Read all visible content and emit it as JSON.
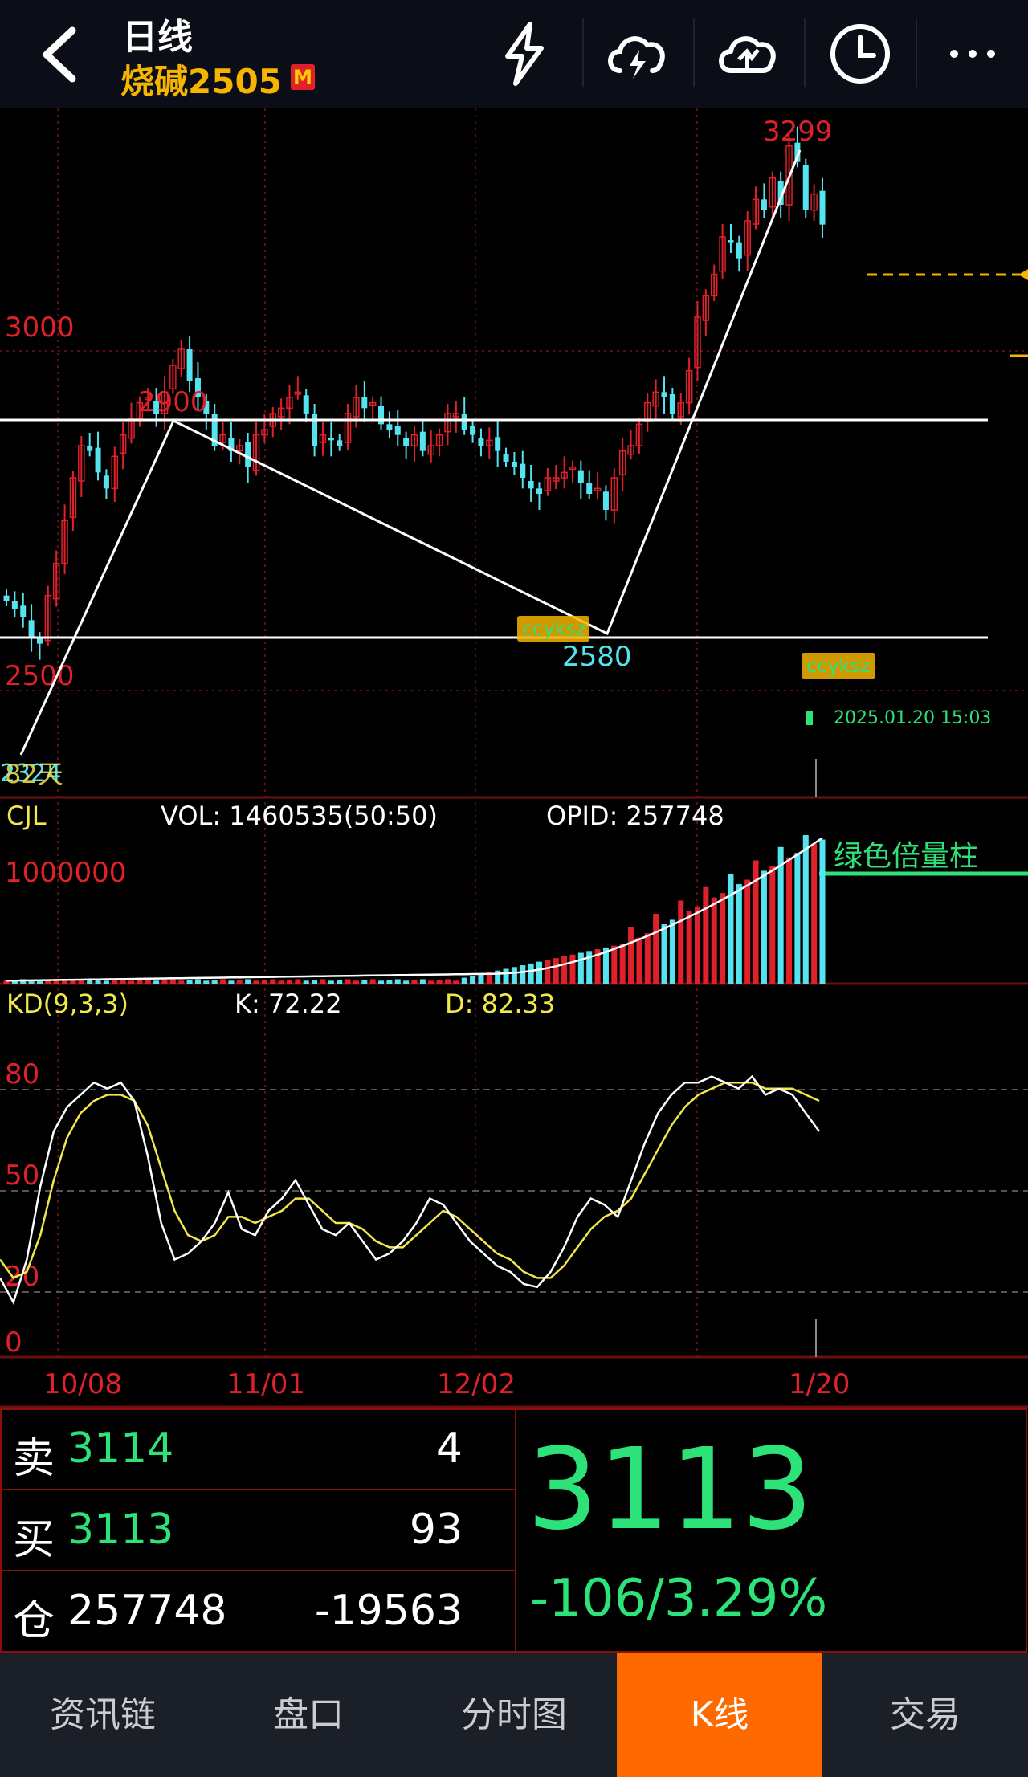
{
  "header": {
    "period": "日线",
    "contract": "烧碱2505",
    "market_badge": "M",
    "icons": [
      "back-icon",
      "lightning-icon",
      "cloud-lightning-icon",
      "cloud-chart-icon",
      "clock-icon",
      "more-icon"
    ]
  },
  "colors": {
    "up": "#e0202a",
    "down": "#56e3f0",
    "accent": "#f5b400",
    "green": "#2ee27a",
    "tab_active": "#ff6a00"
  },
  "chart_data": [
    {
      "type": "candlestick",
      "price_labels": [
        "3000",
        "2500"
      ],
      "annotations": {
        "high": "3299",
        "mid_high": "2900",
        "low": "2580",
        "left_low": "2324",
        "left_text": "82天",
        "tag1": "ccyksz",
        "tag2": "ccyksz",
        "timestamp": "2025.01.20 15:03"
      },
      "support": 2580,
      "resistance": 2900,
      "ylim": [
        2280,
        3330
      ],
      "closes": [
        2410,
        2395,
        2380,
        2340,
        2330,
        2420,
        2480,
        2560,
        2640,
        2700,
        2690,
        2650,
        2620,
        2680,
        2720,
        2750,
        2780,
        2790,
        2760,
        2800,
        2850,
        2880,
        2820,
        2790,
        2760,
        2700,
        2720,
        2690,
        2700,
        2660,
        2720,
        2730,
        2760,
        2770,
        2790,
        2800,
        2760,
        2700,
        2720,
        2710,
        2700,
        2760,
        2790,
        2770,
        2780,
        2740,
        2730,
        2720,
        2700,
        2720,
        2690,
        2700,
        2720,
        2760,
        2760,
        2730,
        2720,
        2700,
        2710,
        2690,
        2670,
        2660,
        2640,
        2620,
        2610,
        2640,
        2640,
        2650,
        2660,
        2630,
        2610,
        2620,
        2580,
        2640,
        2690,
        2700,
        2740,
        2780,
        2800,
        2790,
        2760,
        2780,
        2840,
        2940,
        2980,
        3020,
        3090,
        3080,
        3050,
        3120,
        3160,
        3140,
        3200,
        3150,
        3260,
        3230,
        3140,
        3170,
        3113
      ]
    },
    {
      "type": "bar",
      "label": "CJL",
      "vol_text": "VOL: 1460535(50:50)",
      "opid_text": "OPID: 257748",
      "scale_label": "1000000",
      "legend": "绿色倍量柱"
    },
    {
      "type": "line",
      "label": "KD(9,3,3)",
      "k_text": "K: 72.22",
      "d_text": "D: 82.33",
      "ylim": [
        0,
        100
      ],
      "ticks": [
        "80",
        "50",
        "20",
        "0"
      ],
      "x_labels": [
        "10/08",
        "11/01",
        "12/02",
        "1/20"
      ],
      "k_values": [
        22,
        14,
        28,
        52,
        70,
        78,
        82,
        86,
        84,
        86,
        80,
        62,
        40,
        28,
        30,
        34,
        40,
        50,
        38,
        36,
        44,
        48,
        54,
        46,
        38,
        36,
        40,
        34,
        28,
        30,
        34,
        40,
        48,
        46,
        40,
        34,
        30,
        26,
        24,
        20,
        19,
        24,
        32,
        42,
        48,
        46,
        42,
        54,
        66,
        76,
        82,
        86,
        86,
        88,
        86,
        84,
        88,
        82,
        84,
        82,
        76,
        70
      ],
      "d_values": [
        28,
        22,
        24,
        36,
        54,
        68,
        76,
        80,
        82,
        82,
        80,
        72,
        58,
        44,
        36,
        34,
        36,
        42,
        42,
        40,
        42,
        44,
        48,
        48,
        44,
        40,
        40,
        38,
        34,
        32,
        32,
        36,
        40,
        44,
        42,
        38,
        34,
        30,
        28,
        24,
        22,
        22,
        26,
        32,
        38,
        42,
        44,
        48,
        56,
        64,
        72,
        78,
        82,
        84,
        86,
        86,
        86,
        84,
        84,
        84,
        82,
        80
      ]
    }
  ],
  "quote": {
    "sell_label": "卖",
    "sell_price": "3114",
    "sell_qty": "4",
    "buy_label": "买",
    "buy_price": "3113",
    "buy_qty": "93",
    "oi_label": "仓",
    "oi_value": "257748",
    "oi_change": "-19563",
    "last_price": "3113",
    "change": "-106/3.29%"
  },
  "tabs": [
    {
      "label": "资讯链",
      "active": false
    },
    {
      "label": "盘口",
      "active": false
    },
    {
      "label": "分时图",
      "active": false
    },
    {
      "label": "K线",
      "active": true
    },
    {
      "label": "交易",
      "active": false
    }
  ]
}
